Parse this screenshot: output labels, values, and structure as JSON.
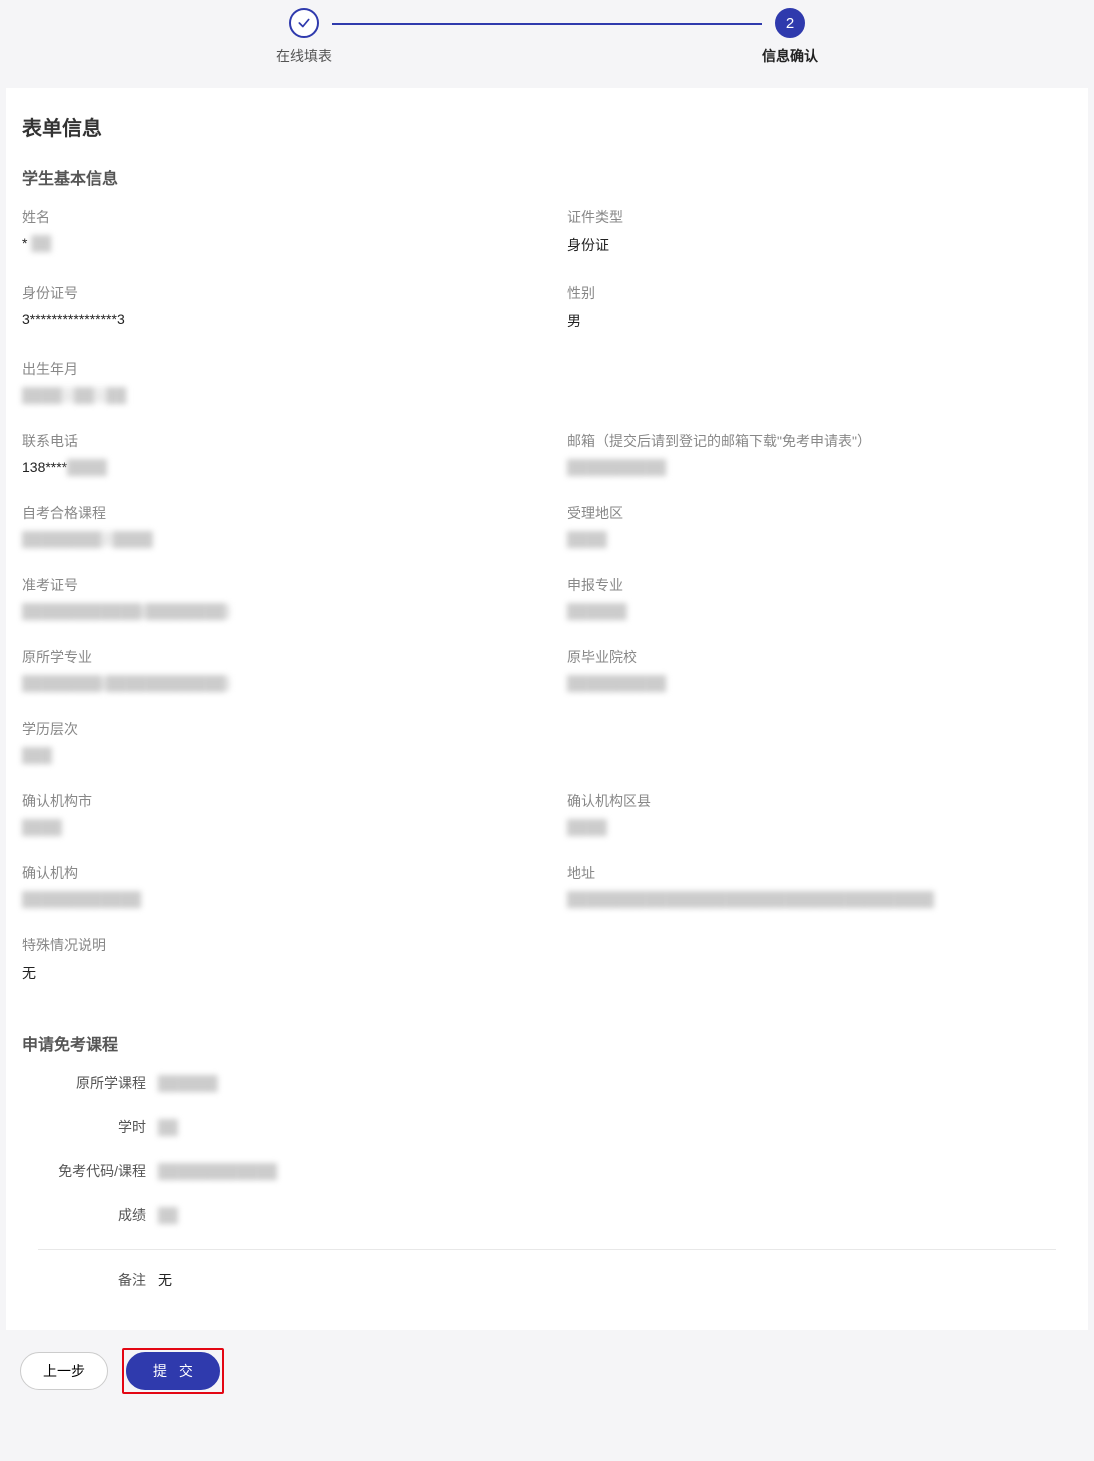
{
  "steps": {
    "step1_label": "在线填表",
    "step2_label": "信息确认",
    "step2_num": "2"
  },
  "card": {
    "title": "表单信息",
    "section_basic": "学生基本信息",
    "section_courses": "申请免考课程"
  },
  "fields": {
    "name_label": "姓名",
    "name_value": "* ",
    "idtype_label": "证件类型",
    "idtype_value": "身份证",
    "idnum_label": "身份证号",
    "idnum_value": "3****************3",
    "gender_label": "性别",
    "gender_value": "男",
    "birth_label": "出生年月",
    "birth_value": "████ - ██ - ██",
    "phone_label": "联系电话",
    "phone_value": "138****████",
    "email_label": "邮箱（提交后请到登记的邮箱下载\"免考申请表\"）",
    "email_value": "██████████",
    "qualified_label": "自考合格课程",
    "qualified_value": "████████ / ████",
    "region_label": "受理地区",
    "region_value": "████",
    "examid_label": "准考证号",
    "examid_value": "████████████(████████)",
    "major_label": "申报专业",
    "major_value": "██████",
    "origmajor_label": "原所学专业",
    "origmajor_value": "████████(████████████)",
    "origschool_label": "原毕业院校",
    "origschool_value": "██████████",
    "edulevel_label": "学历层次",
    "edulevel_value": "███",
    "city_label": "确认机构市",
    "city_value": "████",
    "district_label": "确认机构区县",
    "district_value": "████",
    "org_label": "确认机构",
    "org_value": "████████████",
    "address_label": "地址",
    "address_value": "█████████████████████████████████████",
    "special_label": "特殊情况说明",
    "special_value": "无"
  },
  "course": {
    "orig_course_label": "原所学课程",
    "orig_course_value": "██████",
    "hours_label": "学时",
    "hours_value": "██",
    "code_label": "免考代码/课程",
    "code_value": "████████████",
    "score_label": "成绩",
    "score_value": "██",
    "remark_label": "备注",
    "remark_value": "无"
  },
  "buttons": {
    "prev": "上一步",
    "submit": "提 交"
  }
}
